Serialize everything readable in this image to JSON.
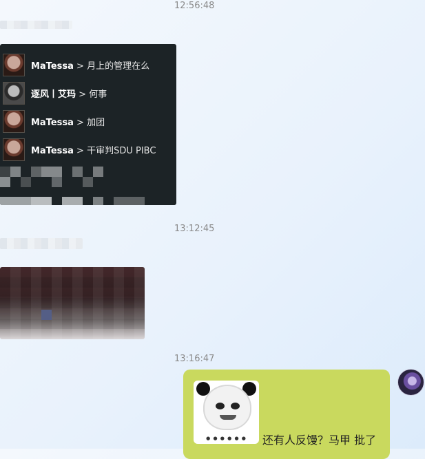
{
  "timestamps": [
    "12:56:48",
    "13:12:45",
    "13:16:47"
  ],
  "game_chat": {
    "rows": [
      {
        "speaker": "MaTessa",
        "separator": " > ",
        "message": "月上的管理在么"
      },
      {
        "speaker": "逐风丨艾玛",
        "separator": " > ",
        "message": "何事"
      },
      {
        "speaker": "MaTessa",
        "separator": " > ",
        "message": "加团"
      },
      {
        "speaker": "MaTessa",
        "separator": " > ",
        "message": "干审判SDU PIBC"
      }
    ]
  },
  "my_message": {
    "text": "还有人反馒？马甲 批了",
    "sticker_caption": "● ● ● ● ● ●",
    "sticker_icon": "panda-meme-icon"
  }
}
